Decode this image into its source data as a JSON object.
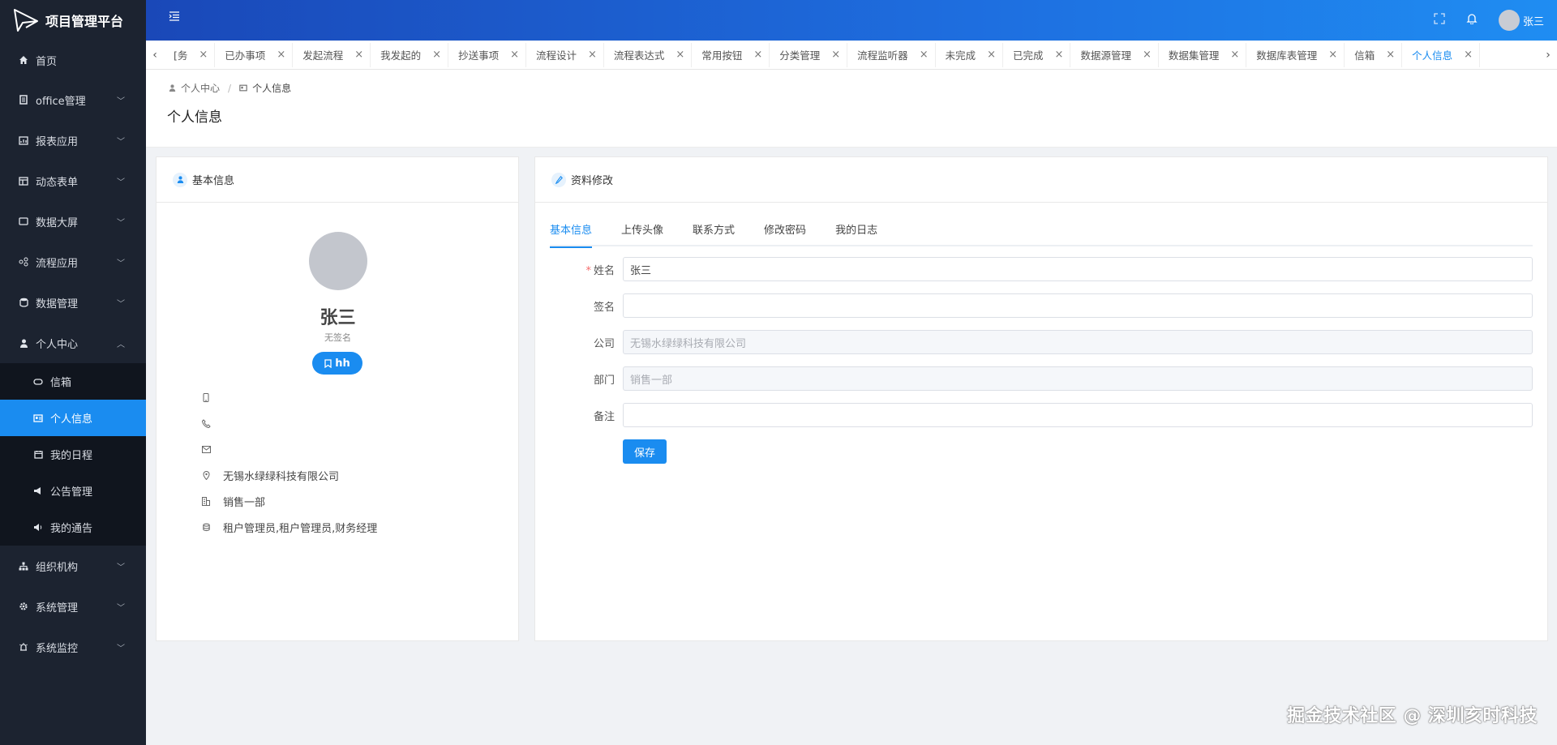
{
  "app": {
    "title": "项目管理平台"
  },
  "sidebar": {
    "items": [
      {
        "label": "首页",
        "icon": "home-icon"
      },
      {
        "label": "office管理",
        "icon": "document-icon"
      },
      {
        "label": "报表应用",
        "icon": "report-icon"
      },
      {
        "label": "动态表单",
        "icon": "form-icon"
      },
      {
        "label": "数据大屏",
        "icon": "screen-icon"
      },
      {
        "label": "流程应用",
        "icon": "flow-icon"
      },
      {
        "label": "数据管理",
        "icon": "database-icon"
      },
      {
        "label": "个人中心",
        "icon": "user-icon"
      }
    ],
    "sub_items": [
      {
        "label": "信箱",
        "icon": "mailbox-icon"
      },
      {
        "label": "个人信息",
        "icon": "id-card-icon"
      },
      {
        "label": "我的日程",
        "icon": "calendar-icon"
      },
      {
        "label": "公告管理",
        "icon": "announcement-icon"
      },
      {
        "label": "我的通告",
        "icon": "notice-icon"
      }
    ],
    "bottom_items": [
      {
        "label": "组织机构",
        "icon": "org-icon"
      },
      {
        "label": "系统管理",
        "icon": "gear-icon"
      },
      {
        "label": "系统监控",
        "icon": "monitor-icon"
      }
    ]
  },
  "header": {
    "username": "张三"
  },
  "tabs": [
    "[务",
    "已办事项",
    "发起流程",
    "我发起的",
    "抄送事项",
    "流程设计",
    "流程表达式",
    "常用按钮",
    "分类管理",
    "流程监听器",
    "未完成",
    "已完成",
    "数据源管理",
    "数据集管理",
    "数据库表管理",
    "信箱",
    "个人信息"
  ],
  "breadcrumb": {
    "parent": "个人中心",
    "current": "个人信息"
  },
  "page_title": "个人信息",
  "profile_card": {
    "title": "基本信息",
    "name": "张三",
    "signature": "无签名",
    "tag": "hh",
    "phone": "",
    "tel": "",
    "email": "",
    "company": "无锡水绿绿科技有限公司",
    "department": "销售一部",
    "roles": "租户管理员,租户管理员,财务经理"
  },
  "edit_card": {
    "title": "资料修改",
    "tabs": [
      "基本信息",
      "上传头像",
      "联系方式",
      "修改密码",
      "我的日志"
    ],
    "fields": {
      "name_label": "姓名",
      "name_value": "张三",
      "signature_label": "签名",
      "signature_value": "",
      "company_label": "公司",
      "company_value": "无锡水绿绿科技有限公司",
      "department_label": "部门",
      "department_value": "销售一部",
      "remark_label": "备注",
      "remark_value": ""
    },
    "save_label": "保存"
  },
  "watermark": "掘金技术社区 @ 深圳亥时科技",
  "colors": {
    "accent": "#1a8cf0",
    "sidebar_bg": "#1c2330",
    "header_start": "#1a48b8",
    "header_end": "#1f8df2"
  }
}
